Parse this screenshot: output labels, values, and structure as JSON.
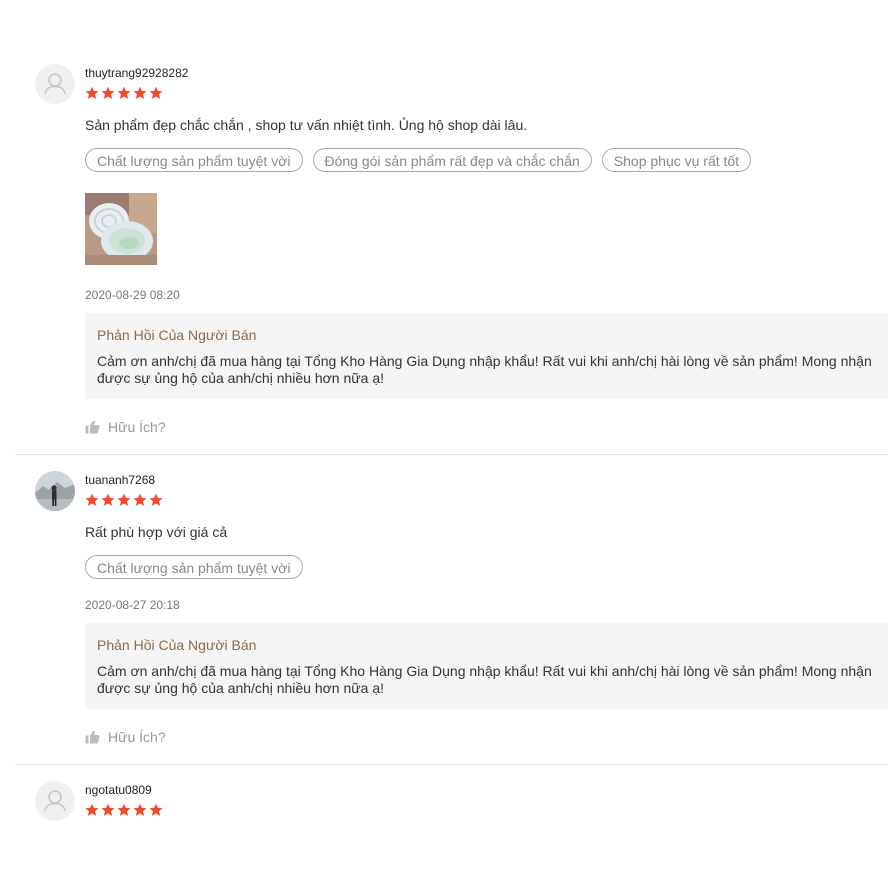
{
  "reviews": [
    {
      "username": "thuytrang92928282",
      "rating": 5,
      "comment": "Sản phẩm đẹp chắc chắn , shop tư vấn nhiệt tình. Ủng hộ shop dài lâu.",
      "tags": [
        "Chất lượng sản phẩm tuyệt vời",
        "Đóng gói sản phẩm rất đẹp và chắc chắn",
        "Shop phục vụ rất tốt"
      ],
      "timestamp": "2020-08-29 08:20",
      "reply_title": "Phản Hồi Của Người Bán",
      "reply_text": "Cảm ơn anh/chị đã mua hàng tại Tổng Kho Hàng Gia Dụng nhập khẩu! Rất vui khi anh/chị hài lòng về sản phẩm! Mong nhận được sự ủng hộ của anh/chị nhiều hơn nữa ạ!",
      "helpful_label": "Hữu Ích?"
    },
    {
      "username": "tuananh7268",
      "rating": 5,
      "comment": "Rất phù hợp với giá cả",
      "tags": [
        "Chất lượng sản phẩm tuyệt vời"
      ],
      "timestamp": "2020-08-27 20:18",
      "reply_title": "Phản Hồi Của Người Bán",
      "reply_text": "Cảm ơn anh/chị đã mua hàng tại Tổng Kho Hàng Gia Dụng nhập khẩu! Rất vui khi anh/chị hài lòng về sản phẩm! Mong nhận được sự ủng hộ của anh/chị nhiều hơn nữa ạ!",
      "helpful_label": "Hữu Ích?"
    },
    {
      "username": "ngotatu0809",
      "rating": 5
    }
  ],
  "colors": {
    "star": "#ee4d2d",
    "reply_title": "#8b6a4a",
    "reply_bg": "#f5f5f5",
    "tag_border": "#aaaaaa",
    "muted_text": "#999999"
  },
  "icons": {
    "avatar_placeholder": "user-silhouette-icon",
    "star": "star-icon",
    "helpful": "thumbs-up-icon"
  }
}
